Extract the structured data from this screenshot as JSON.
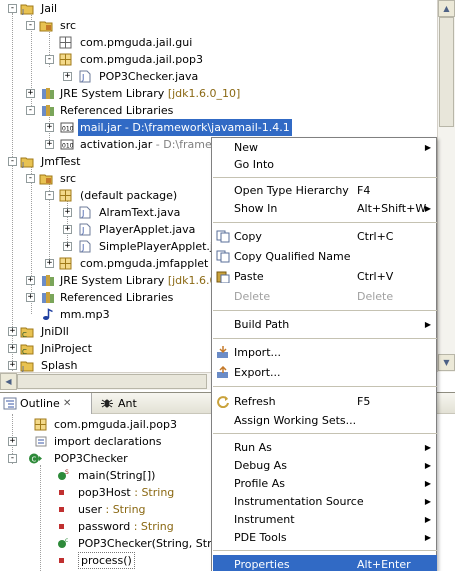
{
  "package_explorer": {
    "rows": [
      {
        "label": "Jail"
      },
      {
        "label": "src"
      },
      {
        "label": "com.pmguda.jail.gui"
      },
      {
        "label": "com.pmguda.jail.pop3"
      },
      {
        "label": "POP3Checker.java"
      },
      {
        "label": "JRE System Library",
        "decoration": "[jdk1.6.0_10]"
      },
      {
        "label": "Referenced Libraries"
      },
      {
        "label": "mail.jar - D:\\framework\\javamail-1.4.1"
      },
      {
        "label": "activation.jar",
        "decoration": " - D:\\framewo"
      },
      {
        "label": "JmfTest"
      },
      {
        "label": "src"
      },
      {
        "label": "(default package)"
      },
      {
        "label": "AlramText.java"
      },
      {
        "label": "PlayerApplet.java"
      },
      {
        "label": "SimplePlayerApplet.jav"
      },
      {
        "label": "com.pmguda.jmfapplet"
      },
      {
        "label": "JRE System Library",
        "decoration": "[jdk1.6.0_1"
      },
      {
        "label": "Referenced Libraries"
      },
      {
        "label": "mm.mp3"
      },
      {
        "label": "JniDll"
      },
      {
        "label": "JniProject"
      },
      {
        "label": "Splash"
      }
    ]
  },
  "views": {
    "outline_tab": "Outline",
    "outline_close": "✕",
    "ant_tab": "Ant"
  },
  "outline": {
    "rows": [
      {
        "label": "com.pmguda.jail.pop3"
      },
      {
        "label": "import declarations"
      },
      {
        "label": "POP3Checker"
      },
      {
        "label": "main(String[])"
      },
      {
        "label": "pop3Host",
        "decoration": " : String"
      },
      {
        "label": "user",
        "decoration": " : String"
      },
      {
        "label": "password",
        "decoration": " : String"
      },
      {
        "label": "POP3Checker(String, String"
      },
      {
        "label": "process()"
      }
    ]
  },
  "context_menu": {
    "items": [
      {
        "label": "New",
        "submenu": "▶"
      },
      {
        "label": "Go Into"
      },
      {
        "label": "Open Type Hierarchy",
        "shortcut": "F4"
      },
      {
        "label": "Show In",
        "shortcut": "Alt+Shift+W",
        "submenu": "▶"
      },
      {
        "label": "Copy",
        "shortcut": "Ctrl+C"
      },
      {
        "label": "Copy Qualified Name"
      },
      {
        "label": "Paste",
        "shortcut": "Ctrl+V"
      },
      {
        "label": "Delete",
        "shortcut": "Delete"
      },
      {
        "label": "Build Path",
        "submenu": "▶"
      },
      {
        "label": "Import..."
      },
      {
        "label": "Export..."
      },
      {
        "label": "Refresh",
        "shortcut": "F5"
      },
      {
        "label": "Assign Working Sets..."
      },
      {
        "label": "Run As",
        "submenu": "▶"
      },
      {
        "label": "Debug As",
        "submenu": "▶"
      },
      {
        "label": "Profile As",
        "submenu": "▶"
      },
      {
        "label": "Instrumentation Source",
        "submenu": "▶"
      },
      {
        "label": "Instrument",
        "submenu": "▶"
      },
      {
        "label": "PDE Tools",
        "submenu": "▶"
      },
      {
        "label": "Properties",
        "shortcut": "Alt+Enter"
      }
    ]
  },
  "scroll_glyphs": {
    "up": "▲",
    "down": "▼",
    "left": "◀",
    "right": "▶"
  },
  "colors": {
    "selection": "#316ac5",
    "decoration": "#8b6914",
    "menu_border": "#808080"
  }
}
